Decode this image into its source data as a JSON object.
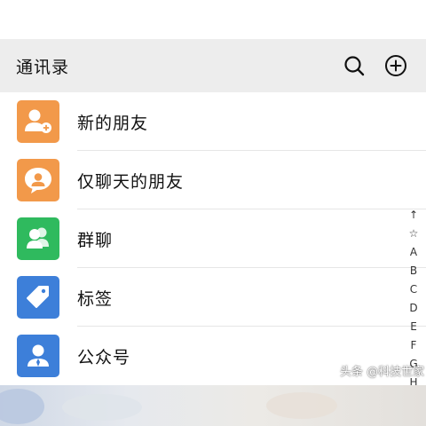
{
  "header": {
    "title": "通讯录",
    "search_icon": "search-icon",
    "add_icon": "add-circle-icon"
  },
  "colors": {
    "orange": "#f2994a",
    "green": "#2fba5e",
    "blue": "#3d7fd9"
  },
  "items": [
    {
      "label": "新的朋友",
      "icon": "new-friend-icon",
      "color": "#f2994a"
    },
    {
      "label": "仅聊天的朋友",
      "icon": "chat-only-friend-icon",
      "color": "#f2994a"
    },
    {
      "label": "群聊",
      "icon": "group-chat-icon",
      "color": "#2fba5e"
    },
    {
      "label": "标签",
      "icon": "tag-icon",
      "color": "#3d7fd9"
    },
    {
      "label": "公众号",
      "icon": "official-account-icon",
      "color": "#3d7fd9"
    }
  ],
  "index_bar": [
    "↑",
    "☆",
    "A",
    "B",
    "C",
    "D",
    "E",
    "F",
    "G",
    "H"
  ],
  "watermark": "头条 @科技世家"
}
